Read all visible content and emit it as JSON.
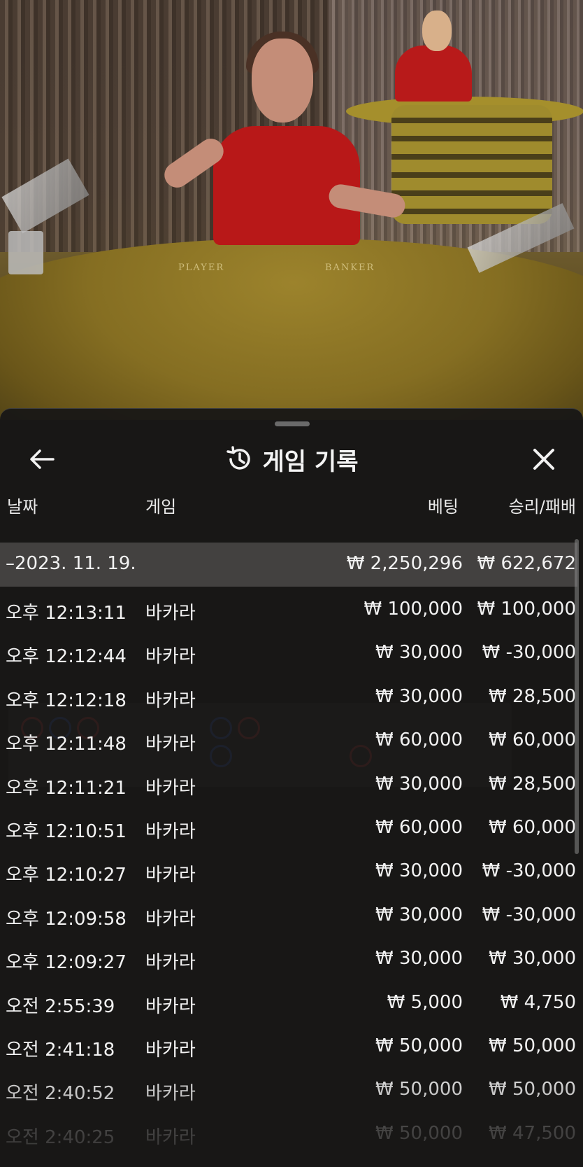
{
  "video": {
    "felt_player": "PLAYER",
    "felt_banker": "BANKER"
  },
  "sheet": {
    "title": "게임 기록",
    "icons": {
      "back": "arrow-left-icon",
      "history": "history-icon",
      "close": "close-icon"
    },
    "columns": {
      "date": "날짜",
      "game": "게임",
      "bet": "베팅",
      "win_loss": "승리/패배"
    },
    "group": {
      "date": "–2023. 11. 19.",
      "bet_total": "₩ 2,250,296",
      "win_total": "₩ 622,672"
    },
    "rows": [
      {
        "time": "오후 12:13:11",
        "game": "바카라",
        "bet": "₩ 100,000",
        "win": "₩ 100,000"
      },
      {
        "time": "오후 12:12:44",
        "game": "바카라",
        "bet": "₩ 30,000",
        "win": "₩ -30,000"
      },
      {
        "time": "오후 12:12:18",
        "game": "바카라",
        "bet": "₩ 30,000",
        "win": "₩ 28,500"
      },
      {
        "time": "오후 12:11:48",
        "game": "바카라",
        "bet": "₩ 60,000",
        "win": "₩ 60,000"
      },
      {
        "time": "오후 12:11:21",
        "game": "바카라",
        "bet": "₩ 30,000",
        "win": "₩ 28,500"
      },
      {
        "time": "오후 12:10:51",
        "game": "바카라",
        "bet": "₩ 60,000",
        "win": "₩ 60,000"
      },
      {
        "time": "오후 12:10:27",
        "game": "바카라",
        "bet": "₩ 30,000",
        "win": "₩ -30,000"
      },
      {
        "time": "오후 12:09:58",
        "game": "바카라",
        "bet": "₩ 30,000",
        "win": "₩ -30,000"
      },
      {
        "time": "오후 12:09:27",
        "game": "바카라",
        "bet": "₩ 30,000",
        "win": "₩ 30,000"
      },
      {
        "time": "오전 2:55:39",
        "game": "바카라",
        "bet": "₩ 5,000",
        "win": "₩ 4,750"
      },
      {
        "time": "오전 2:41:18",
        "game": "바카라",
        "bet": "₩ 50,000",
        "win": "₩ 50,000"
      },
      {
        "time": "오전 2:40:52",
        "game": "바카라",
        "bet": "₩ 50,000",
        "win": "₩ 50,000"
      },
      {
        "time": "오전 2:40:25",
        "game": "바카라",
        "bet": "₩ 50,000",
        "win": "₩ 47,500"
      }
    ]
  }
}
